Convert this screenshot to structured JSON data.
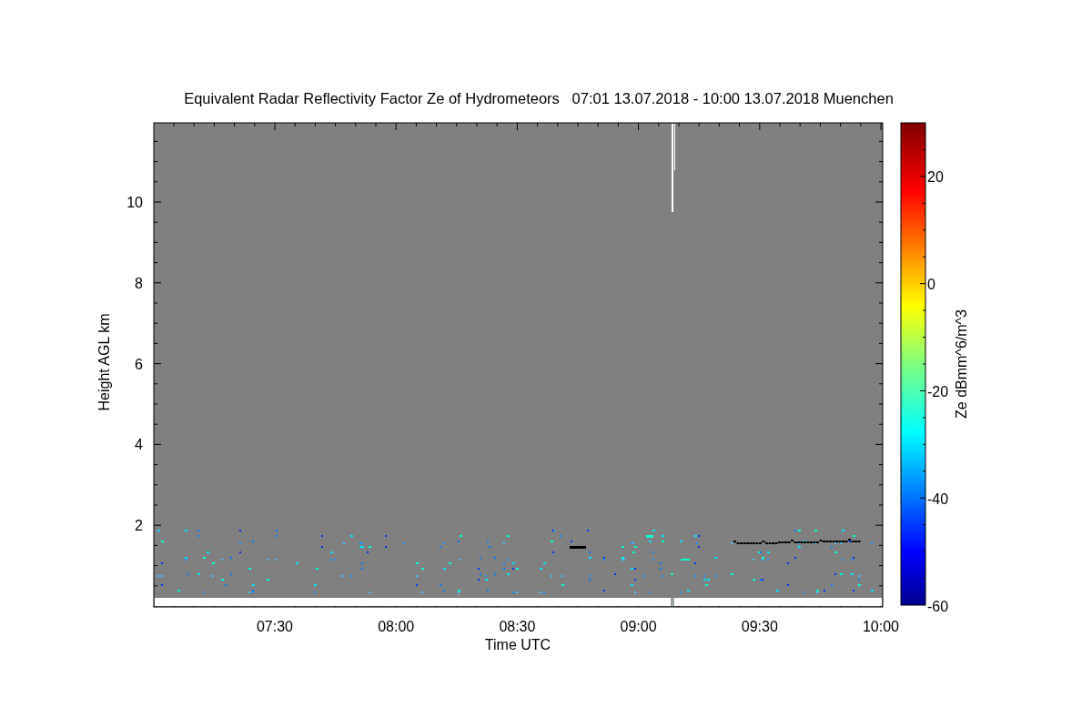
{
  "chart": {
    "title": "Equivalent Radar Reflectivity Factor Ze of Hydrometeors   07:01 13.07.2018 - 10:00 13.07.2018 Muenchen",
    "xlabel": "Time UTC",
    "ylabel": "Height AGL km",
    "xticks": [
      "07:30",
      "08:00",
      "08:30",
      "09:00",
      "09:30",
      "10:00"
    ],
    "yticks": [
      "10",
      "8",
      "6",
      "4",
      "2"
    ],
    "colorbar": {
      "label": "Ze dBmm^6/m^3",
      "ticks": [
        "20",
        "0",
        "-20",
        "-40",
        "-60"
      ]
    }
  }
}
